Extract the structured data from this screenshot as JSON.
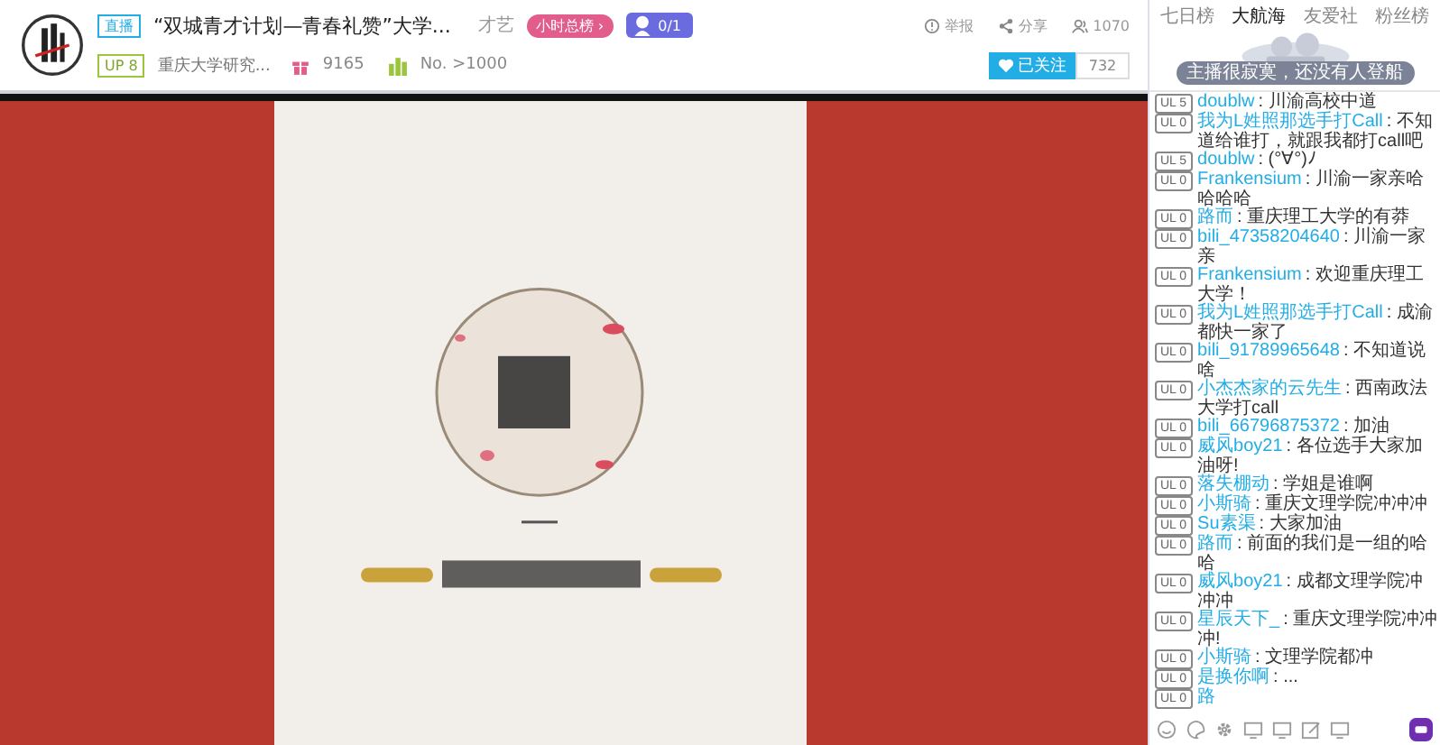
{
  "room": {
    "tag": "直播",
    "title": "“双城青才计划—青春礼赞”大学...",
    "category": "才艺",
    "rank_pill": "小时总榜 ›",
    "badge": "0/1",
    "actions": [
      {
        "kind": "report",
        "label": "举报"
      },
      {
        "kind": "share",
        "label": "分享"
      },
      {
        "kind": "viewers",
        "label": "1070"
      }
    ],
    "up_level": "UP 8",
    "streamer": "重庆大学研究...",
    "gifts": "9165",
    "rank": "No. >1000",
    "follow": {
      "label": "已关注",
      "following": true,
      "count": "732"
    }
  },
  "tabs": [
    {
      "label": "七日榜",
      "selected": false
    },
    {
      "label": "大航海",
      "selected": true
    },
    {
      "label": "友爱社",
      "selected": false
    },
    {
      "label": "粉丝榜",
      "selected": false
    }
  ],
  "notice": "主播很寂寞，还没有人登船",
  "chat": [
    {
      "level": "UL 5",
      "user": "doublw",
      "text": ": 川渝高校中道"
    },
    {
      "level": "UL 0",
      "user": "我为L姓照那选手打Call",
      "text": ": 不知道给谁打，就跟我都打call吧"
    },
    {
      "level": "UL 5",
      "user": "doublw",
      "text": ": (°∀°)ﾉ"
    },
    {
      "level": "UL 0",
      "user": "Frankensium",
      "text": ": 川渝一家亲哈哈哈哈"
    },
    {
      "level": "UL 0",
      "user": "路而",
      "text": ": 重庆理工大学的有莽"
    },
    {
      "level": "UL 0",
      "user": "bili_47358204640",
      "text": ": 川渝一家亲"
    },
    {
      "level": "UL 0",
      "user": "Frankensium",
      "text": ": 欢迎重庆理工大学！"
    },
    {
      "level": "UL 0",
      "user": "我为L姓照那选手打Call",
      "text": ": 成渝都快一家了"
    },
    {
      "level": "UL 0",
      "user": "bili_91789965648",
      "text": ": 不知道说啥"
    },
    {
      "level": "UL 0",
      "user": "小杰杰家的云先生",
      "text": ": 西南政法大学打call"
    },
    {
      "level": "UL 0",
      "user": "bili_66796875372",
      "text": ": 加油"
    },
    {
      "level": "UL 0",
      "user": "威风boy21",
      "text": ": 各位选手大家加油呀!"
    },
    {
      "level": "UL 0",
      "user": "落失棚动",
      "text": ": 学姐是谁啊"
    },
    {
      "level": "UL 0",
      "user": "小斯骑",
      "text": ": 重庆文理学院冲冲冲"
    },
    {
      "level": "UL 0",
      "user": "Su素渠",
      "text": ": 大家加油"
    },
    {
      "level": "UL 0",
      "user": "路而",
      "text": ": 前面的我们是一组的哈哈"
    },
    {
      "level": "UL 0",
      "user": "威风boy21",
      "text": ": 成都文理学院冲冲冲"
    },
    {
      "level": "UL 0",
      "user": "星辰天下_",
      "text": ": 重庆文理学院冲冲冲!"
    },
    {
      "level": "UL 0",
      "user": "小斯骑",
      "text": ": 文理学院都冲"
    },
    {
      "level": "UL 0",
      "user": "是换你啊",
      "text": ": ..."
    },
    {
      "level": "UL 0",
      "user": "路"
    }
  ],
  "toolbar": [
    {
      "kind": "emoji"
    },
    {
      "kind": "palette"
    },
    {
      "kind": "gear"
    },
    {
      "kind": "screen"
    },
    {
      "kind": "screen"
    },
    {
      "kind": "edit"
    },
    {
      "kind": "screen"
    },
    {
      "kind": "send"
    }
  ]
}
